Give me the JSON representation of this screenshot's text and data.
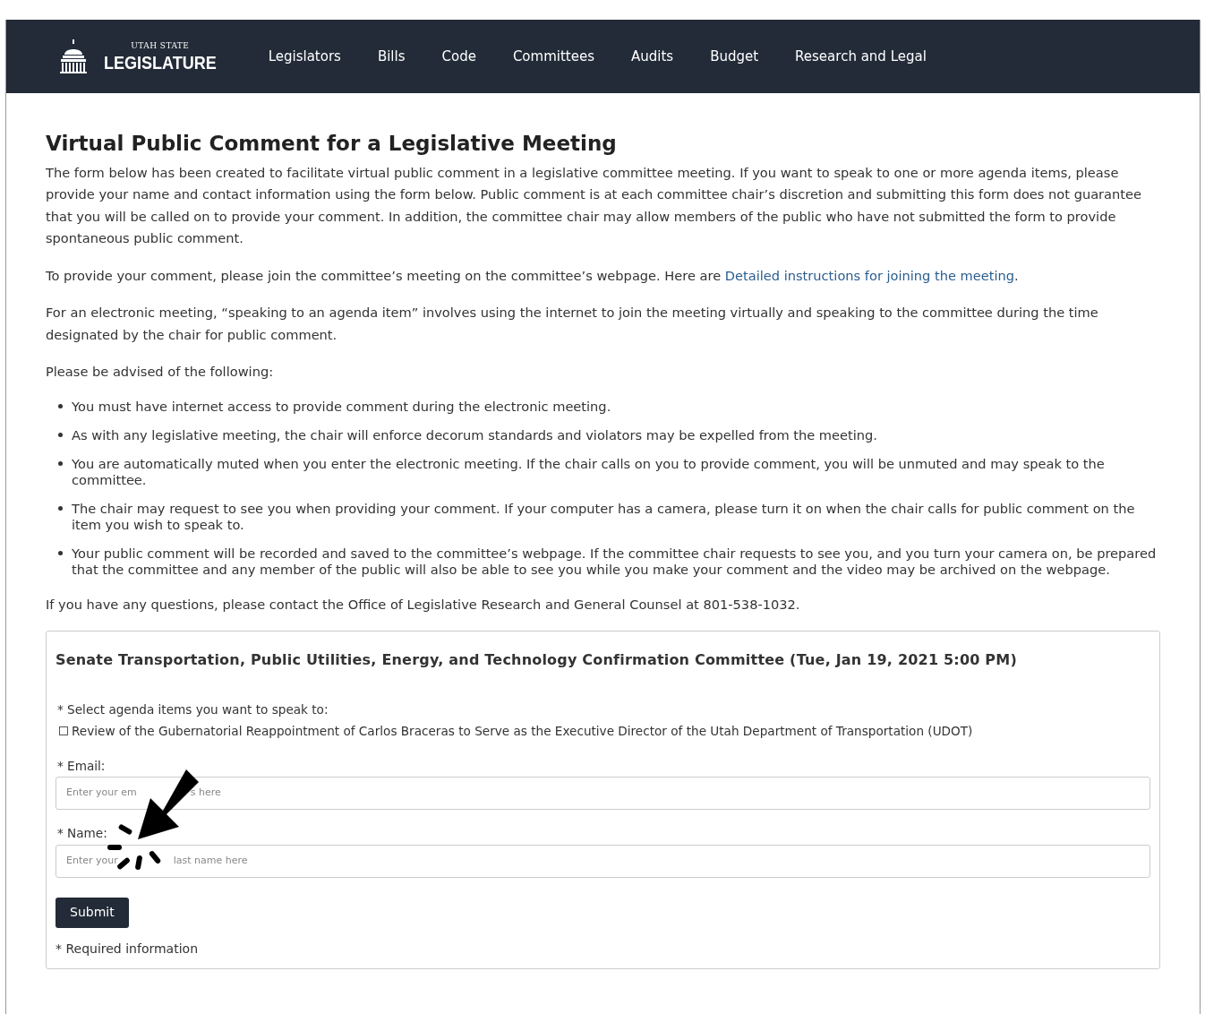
{
  "header": {
    "logo_small": "UTAH STATE",
    "logo_large": "LEGISLATURE",
    "nav": [
      "Legislators",
      "Bills",
      "Code",
      "Committees",
      "Audits",
      "Budget",
      "Research and Legal"
    ]
  },
  "page": {
    "title": "Virtual Public Comment for a Legislative Meeting",
    "intro": "The form below has been created to facilitate virtual public comment in a legislative committee meeting. If you want to speak to one or more agenda items, please provide your name and contact information using the form below. Public comment is at each committee chair’s discretion and submitting this form does not guarantee that you will be called on to provide your comment. In addition, the committee chair may allow members of the public who have not submitted the form to provide spontaneous public comment.",
    "join_text": "To provide your comment, please join the committee’s meeting on the committee’s webpage. Here are",
    "join_link": "Detailed instructions for joining the meeting",
    "join_end": ".",
    "electronic": "For an electronic meeting, “speaking to an agenda item” involves using the internet to join the meeting virtually and speaking to the committee during the time designated by the chair for public comment.",
    "advised": "Please be advised of the following:",
    "bullets": [
      "You must have internet access to provide comment during the electronic meeting.",
      "As with any legislative meeting, the chair will enforce decorum standards and violators may be expelled from the meeting.",
      "You are automatically muted when you enter the electronic meeting. If the chair calls on you to provide comment, you will be unmuted and may speak to the committee.",
      "The chair may request to see you when providing your comment. If your computer has a camera, please turn it on when the chair calls for public comment on the item you wish to speak to.",
      "Your public comment will be recorded and saved to the committee’s webpage. If the committee chair requests to see you, and you turn your camera on, be prepared that the committee and any member of the public will also be able to see you while you make your comment and the video may be archived on the webpage."
    ],
    "contact": "If you have any questions, please contact the Office of Legislative Research and General Counsel at 801-538-1032."
  },
  "form": {
    "title": "Senate Transportation, Public Utilities, Energy, and Technology Confirmation Committee (Tue, Jan 19, 2021 5:00 PM)",
    "agenda_label": "* Select agenda items you want to speak to:",
    "agenda_items": [
      {
        "label": "Review of the Gubernatorial Reappointment of Carlos Braceras to Serve as the Executive Director of the Utah Department of Transportation (UDOT)",
        "checked": false
      }
    ],
    "email_label": "* Email:",
    "email_placeholder_parts": [
      "Enter your em",
      "s here"
    ],
    "name_label": "* Name:",
    "name_placeholder_parts": [
      "Enter your",
      "last name here"
    ],
    "submit": "Submit",
    "required_note": "* Required information"
  }
}
